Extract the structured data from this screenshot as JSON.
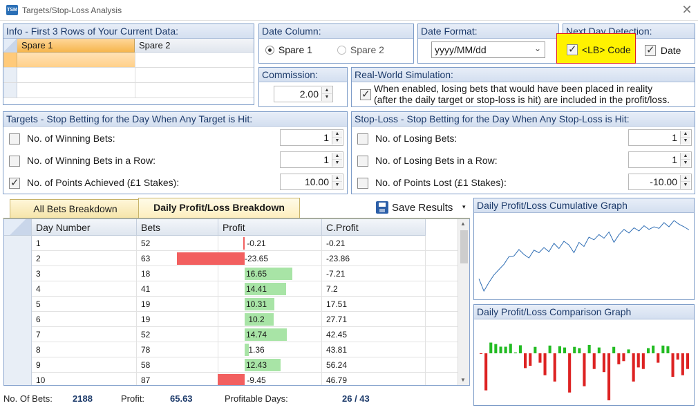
{
  "window": {
    "title": "Targets/Stop-Loss Analysis",
    "icon": "TSM"
  },
  "info": {
    "title": "Info - First 3 Rows of Your Current Data:",
    "columns": [
      "Spare 1",
      "Spare 2"
    ]
  },
  "date_column": {
    "title": "Date Column:",
    "option1": "Spare 1",
    "option2": "Spare 2",
    "selected": "Spare 1"
  },
  "date_format": {
    "title": "Date Format:",
    "value": "yyyy/MM/dd"
  },
  "next_day": {
    "title": "Next Day Detection:",
    "lb_code_label": "<LB> Code",
    "date_label": "Date",
    "lb_code_checked": true,
    "date_checked": true
  },
  "commission": {
    "title": "Commission:",
    "value": "2.00"
  },
  "real_world": {
    "title": "Real-World Simulation:",
    "line1": "When enabled, losing bets that would have been placed in reality",
    "line2": "(after the daily target or stop-loss is hit) are included in the profit/loss.",
    "checked": true
  },
  "targets": {
    "title": "Targets - Stop Betting for the Day When Any Target is Hit:",
    "rows": [
      {
        "label": "No. of Winning Bets:",
        "value": "1",
        "checked": false
      },
      {
        "label": "No. of Winning Bets in a Row:",
        "value": "1",
        "checked": false
      },
      {
        "label": "No. of Points Achieved (£1 Stakes):",
        "value": "10.00",
        "checked": true
      }
    ]
  },
  "stoploss": {
    "title": "Stop-Loss - Stop Betting for the Day When Any Stop-Loss is Hit:",
    "rows": [
      {
        "label": "No. of Losing Bets:",
        "value": "1",
        "checked": false
      },
      {
        "label": "No. of Losing Bets in a Row:",
        "value": "1",
        "checked": false
      },
      {
        "label": "No. of Points Lost (£1 Stakes):",
        "value": "-10.00",
        "checked": false
      }
    ]
  },
  "tabs": {
    "tab1": "All Bets Breakdown",
    "tab2": "Daily Profit/Loss Breakdown",
    "save": "Save Results"
  },
  "table": {
    "headers": [
      "Day Number",
      "Bets",
      "Profit",
      "C.Profit"
    ],
    "rows": [
      {
        "day": "1",
        "bets": "52",
        "profit": "-0.21",
        "cprofit": "-0.21",
        "p": -0.21
      },
      {
        "day": "2",
        "bets": "63",
        "profit": "-23.65",
        "cprofit": "-23.86",
        "p": -23.65
      },
      {
        "day": "3",
        "bets": "18",
        "profit": "16.65",
        "cprofit": "-7.21",
        "p": 16.65
      },
      {
        "day": "4",
        "bets": "41",
        "profit": "14.41",
        "cprofit": "7.2",
        "p": 14.41
      },
      {
        "day": "5",
        "bets": "19",
        "profit": "10.31",
        "cprofit": "17.51",
        "p": 10.31
      },
      {
        "day": "6",
        "bets": "19",
        "profit": "10.2",
        "cprofit": "27.71",
        "p": 10.2
      },
      {
        "day": "7",
        "bets": "52",
        "profit": "14.74",
        "cprofit": "42.45",
        "p": 14.74
      },
      {
        "day": "8",
        "bets": "78",
        "profit": "1.36",
        "cprofit": "43.81",
        "p": 1.36
      },
      {
        "day": "9",
        "bets": "58",
        "profit": "12.43",
        "cprofit": "56.24",
        "p": 12.43
      },
      {
        "day": "10",
        "bets": "87",
        "profit": "-9.45",
        "cprofit": "46.79",
        "p": -9.45
      }
    ]
  },
  "stats": {
    "bets_label": "No. Of Bets:",
    "bets_value": "2188",
    "profit_label": "Profit:",
    "profit_value": "65.63",
    "days_label": "Profitable Days:",
    "days_value": "26 / 43"
  },
  "cumulative_chart": {
    "title": "Daily Profit/Loss Cumulative Graph",
    "type": "line",
    "values": [
      -0.21,
      -23.86,
      -7.21,
      7.2,
      17.51,
      27.71,
      42.45,
      43.81,
      56.24,
      46.79,
      40,
      55,
      50,
      60,
      52,
      68,
      58,
      72,
      65,
      50,
      70,
      62,
      80,
      75,
      85,
      78,
      90,
      70,
      85,
      95,
      88,
      98,
      92,
      102,
      95,
      100,
      97,
      108,
      100,
      112,
      105,
      100,
      94
    ]
  },
  "comparison_chart": {
    "title": "Daily Profit/Loss Comparison Graph",
    "type": "bar",
    "values": [
      -0.21,
      -23.65,
      16.65,
      14.41,
      10.31,
      10.2,
      14.74,
      1.36,
      12.43,
      -9.45,
      -8,
      10,
      -6,
      -14,
      12,
      -18,
      11,
      9,
      -25,
      10,
      8,
      -21,
      13,
      -10,
      9,
      -12,
      -30,
      10,
      -7,
      -5,
      6,
      -18,
      -9,
      -10,
      8,
      12,
      -6,
      12,
      11,
      -15,
      -4,
      -14,
      -10
    ],
    "colors": {
      "pos": "#22bb22",
      "neg": "#dd2222"
    }
  }
}
